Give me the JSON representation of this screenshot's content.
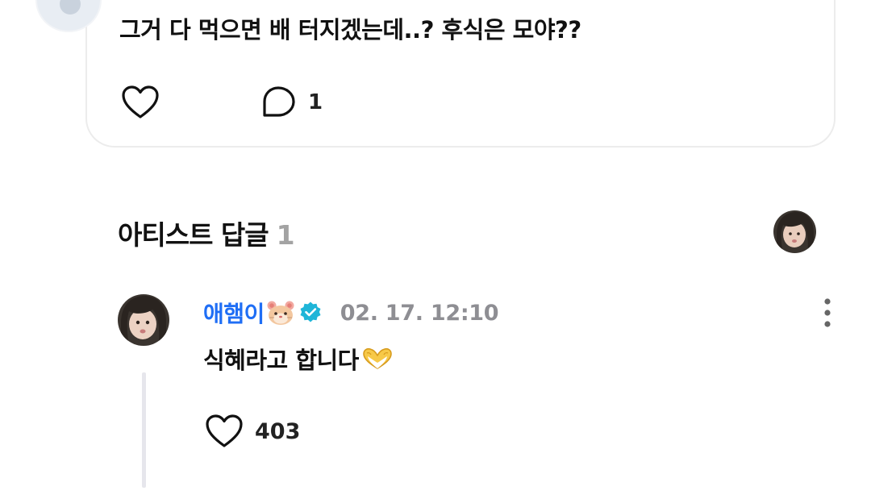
{
  "top_comment": {
    "text": "그거 다 먹으면 배 터지겠는데..? 후식은 모야??",
    "reply_count": "1"
  },
  "artist_replies": {
    "title": "아티스트 답글",
    "count": "1"
  },
  "reply": {
    "author": "애햄이",
    "author_emoji_icon": "hamster-face-icon",
    "verified_icon": "verified-badge-icon",
    "date": "02. 17. 12:10",
    "text": "식혜라고 합니다",
    "text_emoji_icon": "heart-hands-icon",
    "like_count": "403"
  },
  "colors": {
    "author_blue": "#1f6ef5",
    "verified_teal": "#1fb5d8",
    "muted_gray": "#8e8e93",
    "count_gray": "#a3a3a3"
  }
}
